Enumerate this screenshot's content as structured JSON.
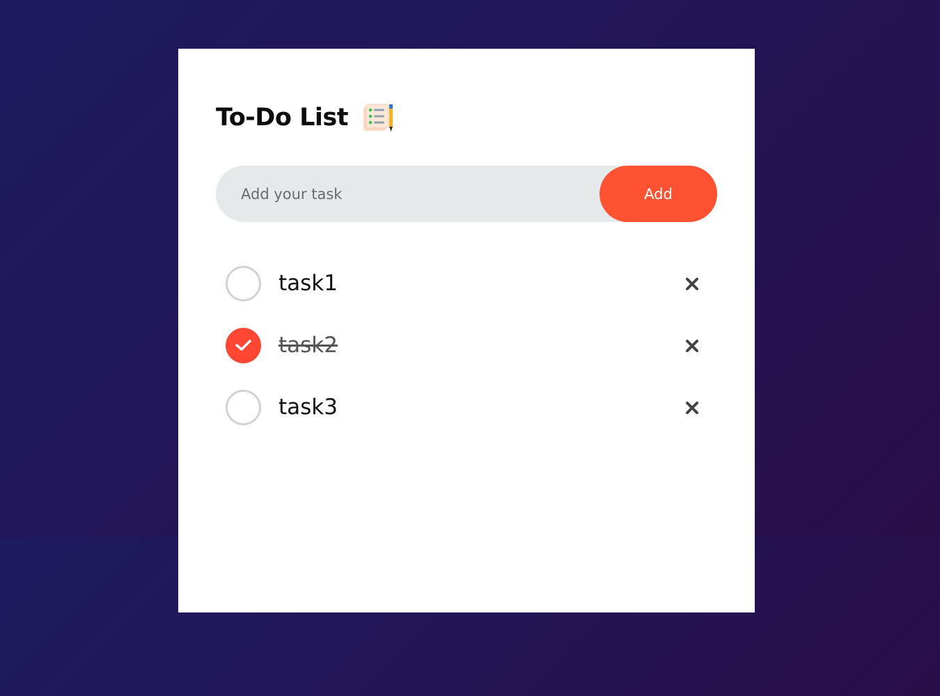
{
  "header": {
    "title": "To-Do List",
    "title_icon": "checklist-notepad-pencil-icon"
  },
  "input": {
    "placeholder": "Add your task",
    "value": "",
    "add_label": "Add"
  },
  "tasks": [
    {
      "text": "task1",
      "checked": false
    },
    {
      "text": "task2",
      "checked": true
    },
    {
      "text": "task3",
      "checked": false
    }
  ],
  "icons": {
    "checked": "checkmark-icon",
    "delete": "close-icon"
  },
  "colors": {
    "accent": "#ff5233",
    "check_fill": "#ff4733",
    "input_bg": "#e6e9e9",
    "background": "#221556"
  }
}
